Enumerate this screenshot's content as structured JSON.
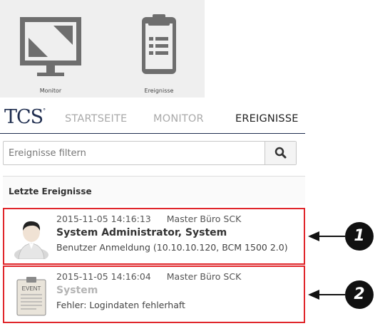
{
  "tiles": [
    {
      "label": "Monitor",
      "icon": "monitor-icon"
    },
    {
      "label": "Ereignisse",
      "icon": "clipboard-list-icon"
    }
  ],
  "nav": {
    "logo": "TCS",
    "items": [
      {
        "label": "STARTSEITE",
        "active": false
      },
      {
        "label": "MONITOR",
        "active": false
      },
      {
        "label": "EREIGNISSE",
        "active": true
      }
    ]
  },
  "filter": {
    "placeholder": "Ereignisse filtern",
    "button_icon": "search-icon"
  },
  "section": {
    "title": "Letzte Ereignisse"
  },
  "events": [
    {
      "timestamp": "2015-11-05 14:16:13",
      "source": "Master Büro SCK",
      "user": "System Administrator, System",
      "message": "Benutzer Anmeldung (10.10.10.120, BCM 1500 2.0)",
      "icon": "user-avatar-icon"
    },
    {
      "timestamp": "2015-11-05 14:16:04",
      "source": "Master Büro SCK",
      "user": "System",
      "message": "Fehler: Logindaten fehlerhaft",
      "icon": "event-clipboard-icon",
      "icon_text": "EVENT"
    }
  ],
  "callouts": [
    "1",
    "2"
  ],
  "colors": {
    "highlight": "#e0262b",
    "brand": "#1f2d4f",
    "tile_bg": "#efefef",
    "icon_gray": "#6e6e6e"
  }
}
